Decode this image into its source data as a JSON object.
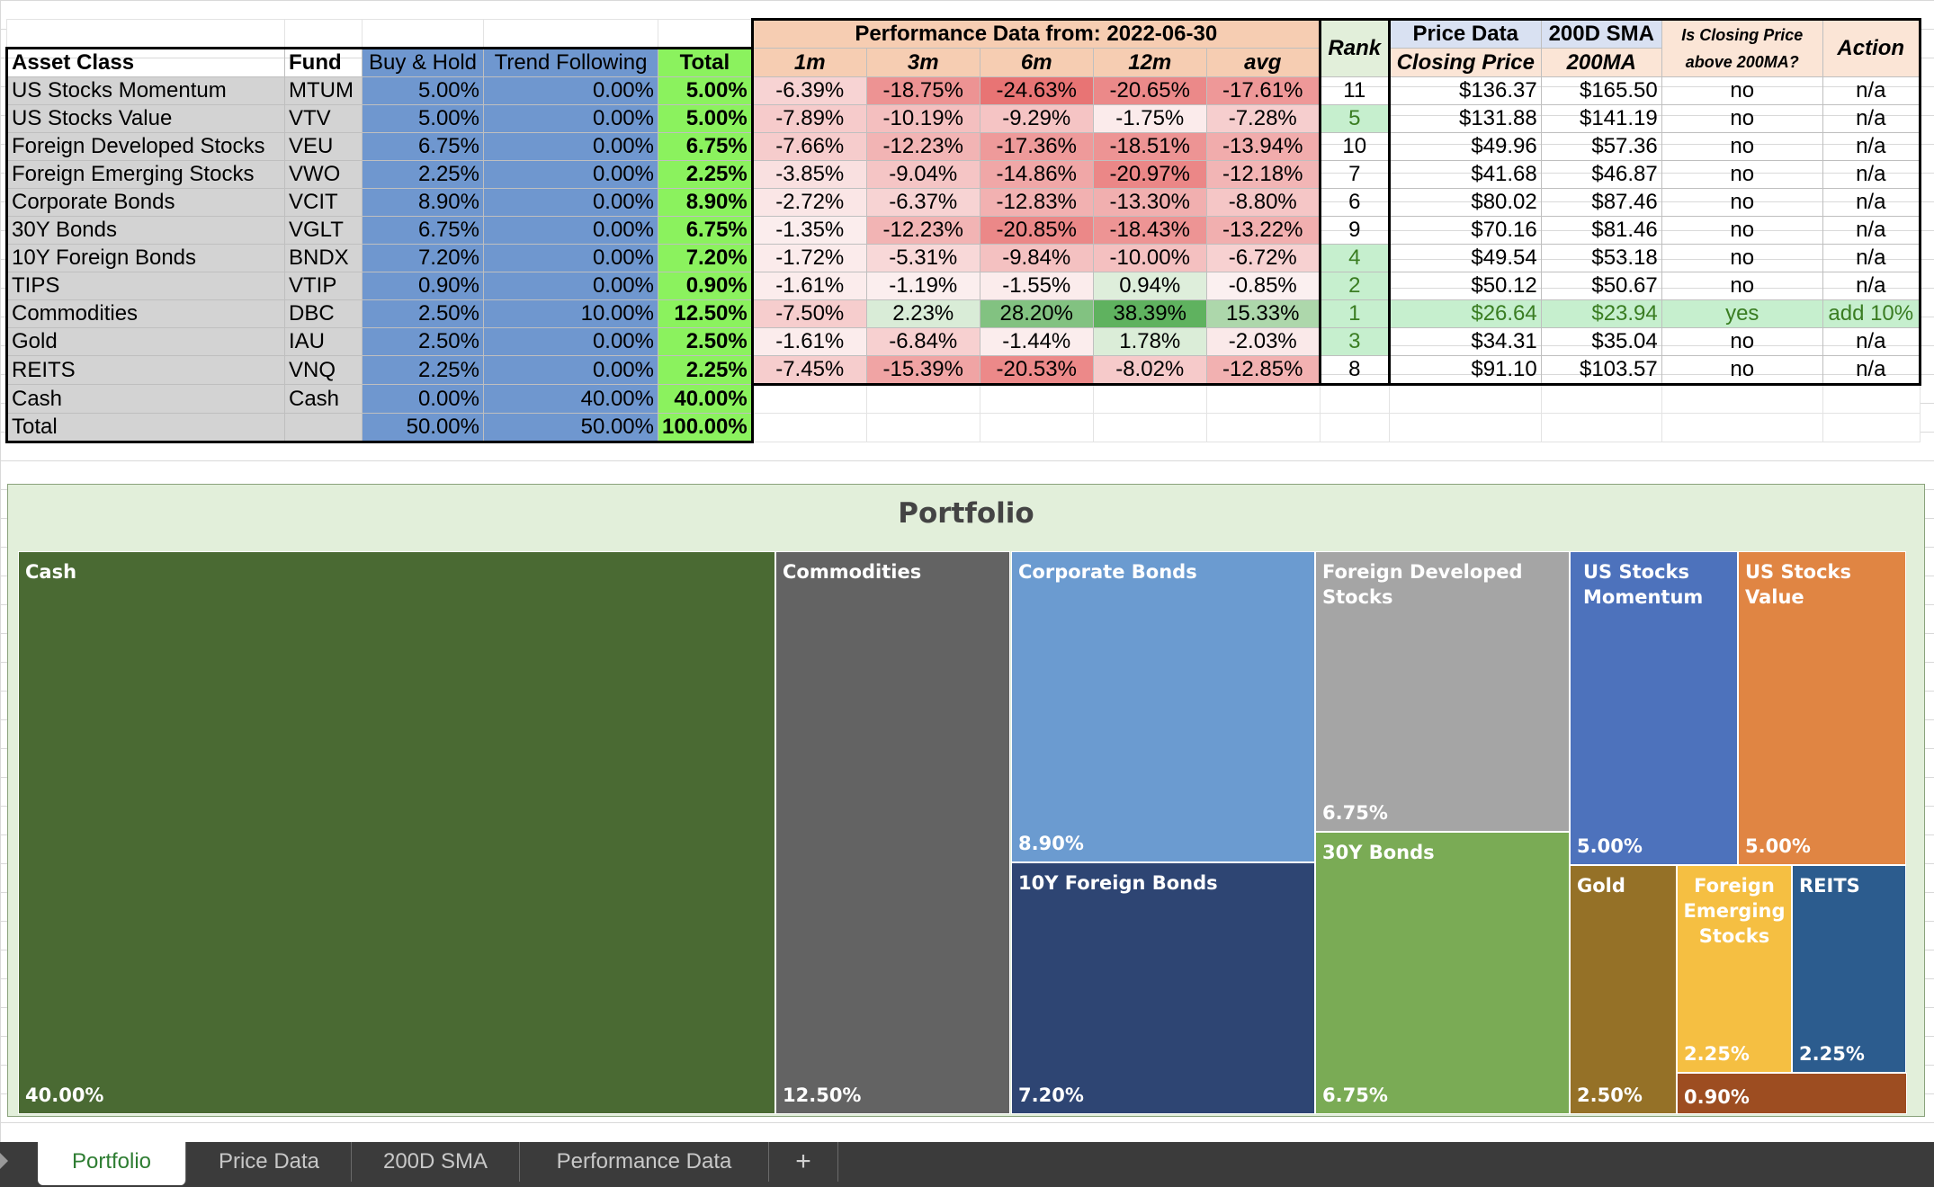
{
  "headers": {
    "asset_class": "Asset Class",
    "fund": "Fund",
    "buy_hold": "Buy & Hold",
    "trend_following": "Trend Following",
    "total": "Total",
    "perf_title": "Performance Data from:  2022-06-30",
    "m1": "1m",
    "m3": "3m",
    "m6": "6m",
    "m12": "12m",
    "avg": "avg",
    "rank": "Rank",
    "price_data": "Price Data",
    "closing_price": "Closing Price",
    "sma": "200D SMA",
    "ma200": "200MA",
    "above_q": "Is Closing Price above 200MA?",
    "action": "Action"
  },
  "rows": [
    {
      "asset": "US Stocks Momentum",
      "fund": "MTUM",
      "bh": "5.00%",
      "tf": "0.00%",
      "total": "5.00%",
      "m1": "-6.39%",
      "m3": "-18.75%",
      "m6": "-24.63%",
      "m12": "-20.65%",
      "avg": "-17.61%",
      "rank": "11",
      "close": "$136.37",
      "ma": "$165.50",
      "above": "no",
      "action": "n/a"
    },
    {
      "asset": "US Stocks Value",
      "fund": "VTV",
      "bh": "5.00%",
      "tf": "0.00%",
      "total": "5.00%",
      "m1": "-7.89%",
      "m3": "-10.19%",
      "m6": "-9.29%",
      "m12": "-1.75%",
      "avg": "-7.28%",
      "rank": "5",
      "close": "$131.88",
      "ma": "$141.19",
      "above": "no",
      "action": "n/a"
    },
    {
      "asset": "Foreign Developed Stocks",
      "fund": "VEU",
      "bh": "6.75%",
      "tf": "0.00%",
      "total": "6.75%",
      "m1": "-7.66%",
      "m3": "-12.23%",
      "m6": "-17.36%",
      "m12": "-18.51%",
      "avg": "-13.94%",
      "rank": "10",
      "close": "$49.96",
      "ma": "$57.36",
      "above": "no",
      "action": "n/a"
    },
    {
      "asset": "Foreign Emerging Stocks",
      "fund": "VWO",
      "bh": "2.25%",
      "tf": "0.00%",
      "total": "2.25%",
      "m1": "-3.85%",
      "m3": "-9.04%",
      "m6": "-14.86%",
      "m12": "-20.97%",
      "avg": "-12.18%",
      "rank": "7",
      "close": "$41.68",
      "ma": "$46.87",
      "above": "no",
      "action": "n/a"
    },
    {
      "asset": "Corporate Bonds",
      "fund": "VCIT",
      "bh": "8.90%",
      "tf": "0.00%",
      "total": "8.90%",
      "m1": "-2.72%",
      "m3": "-6.37%",
      "m6": "-12.83%",
      "m12": "-13.30%",
      "avg": "-8.80%",
      "rank": "6",
      "close": "$80.02",
      "ma": "$87.46",
      "above": "no",
      "action": "n/a"
    },
    {
      "asset": "30Y Bonds",
      "fund": "VGLT",
      "bh": "6.75%",
      "tf": "0.00%",
      "total": "6.75%",
      "m1": "-1.35%",
      "m3": "-12.23%",
      "m6": "-20.85%",
      "m12": "-18.43%",
      "avg": "-13.22%",
      "rank": "9",
      "close": "$70.16",
      "ma": "$81.46",
      "above": "no",
      "action": "n/a"
    },
    {
      "asset": "10Y Foreign Bonds",
      "fund": "BNDX",
      "bh": "7.20%",
      "tf": "0.00%",
      "total": "7.20%",
      "m1": "-1.72%",
      "m3": "-5.31%",
      "m6": "-9.84%",
      "m12": "-10.00%",
      "avg": "-6.72%",
      "rank": "4",
      "close": "$49.54",
      "ma": "$53.18",
      "above": "no",
      "action": "n/a"
    },
    {
      "asset": "TIPS",
      "fund": "VTIP",
      "bh": "0.90%",
      "tf": "0.00%",
      "total": "0.90%",
      "m1": "-1.61%",
      "m3": "-1.19%",
      "m6": "-1.55%",
      "m12": "0.94%",
      "avg": "-0.85%",
      "rank": "2",
      "close": "$50.12",
      "ma": "$50.67",
      "above": "no",
      "action": "n/a"
    },
    {
      "asset": "Commodities",
      "fund": "DBC",
      "bh": "2.50%",
      "tf": "10.00%",
      "total": "12.50%",
      "m1": "-7.50%",
      "m3": "2.23%",
      "m6": "28.20%",
      "m12": "38.39%",
      "avg": "15.33%",
      "rank": "1",
      "close": "$26.64",
      "ma": "$23.94",
      "above": "yes",
      "action": "add 10%"
    },
    {
      "asset": "Gold",
      "fund": "IAU",
      "bh": "2.50%",
      "tf": "0.00%",
      "total": "2.50%",
      "m1": "-1.61%",
      "m3": "-6.84%",
      "m6": "-1.44%",
      "m12": "1.78%",
      "avg": "-2.03%",
      "rank": "3",
      "close": "$34.31",
      "ma": "$35.04",
      "above": "no",
      "action": "n/a"
    },
    {
      "asset": "REITS",
      "fund": "VNQ",
      "bh": "2.25%",
      "tf": "0.00%",
      "total": "2.25%",
      "m1": "-7.45%",
      "m3": "-15.39%",
      "m6": "-20.53%",
      "m12": "-8.02%",
      "avg": "-12.85%",
      "rank": "8",
      "close": "$91.10",
      "ma": "$103.57",
      "above": "no",
      "action": "n/a"
    }
  ],
  "cash_row": {
    "asset": "Cash",
    "fund": "Cash",
    "bh": "0.00%",
    "tf": "40.00%",
    "total": "40.00%"
  },
  "total_row": {
    "asset": "Total",
    "fund": "",
    "bh": "50.00%",
    "tf": "50.00%",
    "total": "100.00%"
  },
  "treemap": {
    "title": "Portfolio",
    "tiles": [
      {
        "key": "cash",
        "label": "Cash",
        "value": "40.00%",
        "color": "#4a6a33"
      },
      {
        "key": "commodities",
        "label": "Commodities",
        "value": "12.50%",
        "color": "#636363"
      },
      {
        "key": "corporate-bonds",
        "label": "Corporate Bonds",
        "value": "8.90%",
        "color": "#6b9bd0"
      },
      {
        "key": "10y-foreign-bonds",
        "label": "10Y Foreign Bonds",
        "value": "7.20%",
        "color": "#2e4573"
      },
      {
        "key": "foreign-developed-stocks",
        "label": "Foreign Developed Stocks",
        "value": "6.75%",
        "color": "#a5a5a5"
      },
      {
        "key": "30y-bonds",
        "label": "30Y Bonds",
        "value": "6.75%",
        "color": "#7aab55"
      },
      {
        "key": "us-stocks-momentum",
        "label": "US Stocks Momentum",
        "value": "5.00%",
        "color": "#4d72bc"
      },
      {
        "key": "us-stocks-value",
        "label": "US Stocks Value",
        "value": "5.00%",
        "color": "#e08543"
      },
      {
        "key": "gold",
        "label": "Gold",
        "value": "2.50%",
        "color": "#957127"
      },
      {
        "key": "foreign-emerging-stocks",
        "label": "Foreign Emerging Stocks",
        "value": "2.25%",
        "color": "#f5bf42"
      },
      {
        "key": "reits",
        "label": "REITS",
        "value": "2.25%",
        "color": "#2c5c8e"
      },
      {
        "key": "tips",
        "label": "",
        "value": "0.90%",
        "color": "#9d4d21"
      }
    ]
  },
  "chart_data": {
    "type": "treemap",
    "title": "Portfolio",
    "categories": [
      "Cash",
      "Commodities",
      "Corporate Bonds",
      "10Y Foreign Bonds",
      "Foreign Developed Stocks",
      "30Y Bonds",
      "US Stocks Momentum",
      "US Stocks Value",
      "Gold",
      "Foreign Emerging Stocks",
      "REITS",
      "TIPS"
    ],
    "values": [
      40.0,
      12.5,
      8.9,
      7.2,
      6.75,
      6.75,
      5.0,
      5.0,
      2.5,
      2.25,
      2.25,
      0.9
    ],
    "unit": "%"
  },
  "tabs": [
    "Portfolio",
    "Price Data",
    "200D SMA",
    "Performance Data",
    "+"
  ],
  "active_tab": "Portfolio"
}
